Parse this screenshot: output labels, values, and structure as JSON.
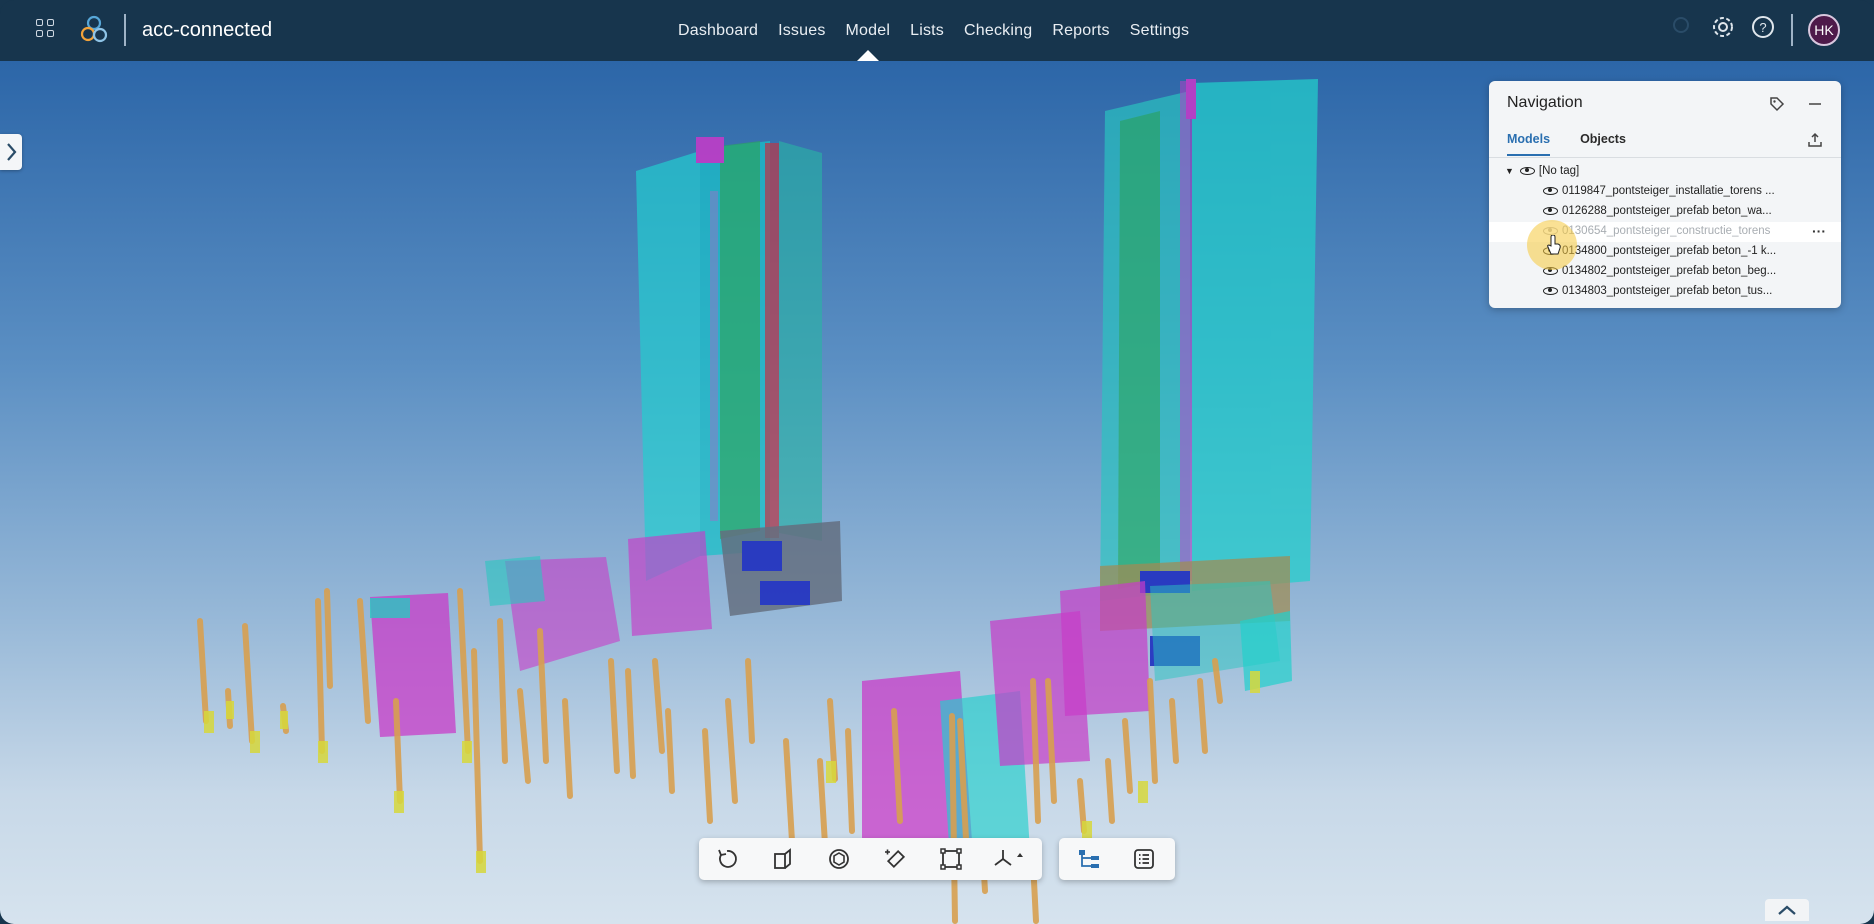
{
  "app": {
    "title": "acc-connected"
  },
  "nav": {
    "items": [
      "Dashboard",
      "Issues",
      "Model",
      "Lists",
      "Checking",
      "Reports",
      "Settings"
    ],
    "active": "Model"
  },
  "user": {
    "initials": "HK"
  },
  "panel": {
    "title": "Navigation",
    "tabs": [
      "Models",
      "Objects"
    ],
    "active_tab": "Models",
    "group": "[No tag]",
    "models": [
      "0119847_pontsteiger_installatie_torens ...",
      "0126288_pontsteiger_prefab beton_wa...",
      "0130654_pontsteiger_constructie_torens",
      "0134800_pontsteiger_prefab beton_-1 k...",
      "0134802_pontsteiger_prefab beton_beg...",
      "0134803_pontsteiger_prefab beton_tus..."
    ],
    "hidden_model_index": 2
  },
  "icons": {
    "apps": "apps-grid-icon",
    "logo": "trimble-connect-logo",
    "search": "search-icon",
    "settings": "gear-icon",
    "help": "help-icon",
    "tag": "tag-icon",
    "minimize": "minimize-icon",
    "export": "export-icon",
    "more": "more-icon",
    "toolbar": [
      "reset-view-icon",
      "section-icon",
      "view-cube-icon",
      "measure-icon",
      "selection-box-icon",
      "axes-icon",
      "model-tree-icon",
      "properties-list-icon"
    ]
  },
  "colors": {
    "topbar": "#17354d",
    "accent": "#2a6fb0",
    "avatar": "#4e1a4a"
  }
}
